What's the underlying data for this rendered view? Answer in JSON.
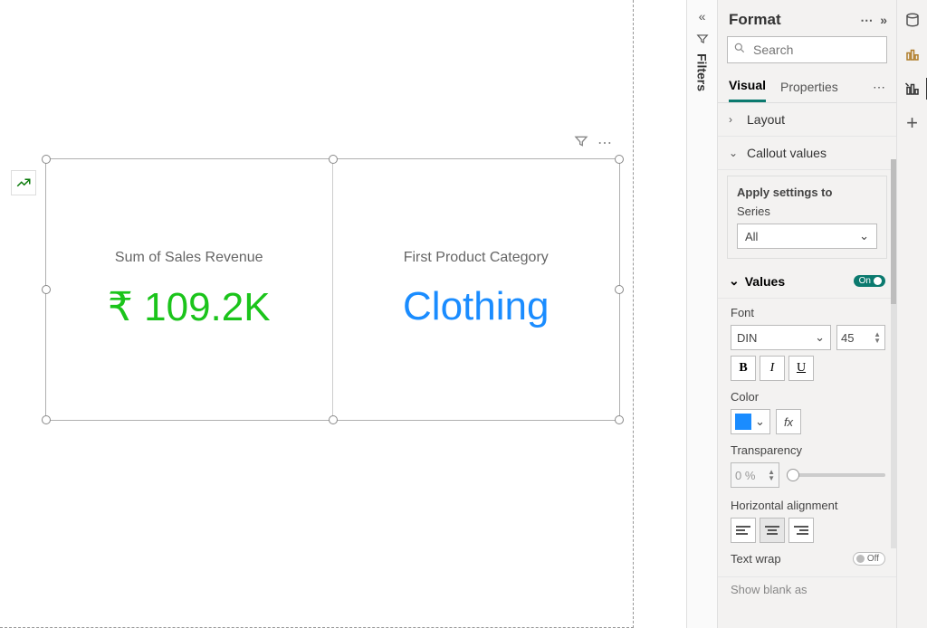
{
  "canvas": {
    "card1_title": "Sum of Sales Revenue",
    "card1_value": "₹ 109.2K",
    "card2_title": "First Product Category",
    "card2_value": "Clothing"
  },
  "filters": {
    "label": "Filters"
  },
  "format": {
    "title": "Format",
    "search_placeholder": "Search",
    "tabs": {
      "visual": "Visual",
      "properties": "Properties"
    },
    "layout": {
      "label": "Layout"
    },
    "callout": {
      "label": "Callout values",
      "apply_label": "Apply settings to",
      "series_label": "Series",
      "series_value": "All"
    },
    "values": {
      "label": "Values",
      "toggle": "On",
      "font_label": "Font",
      "font_family": "DIN",
      "font_size": "45",
      "bold": "B",
      "italic": "I",
      "underline": "U",
      "color_label": "Color",
      "color_hex": "#1a8cff",
      "fx": "fx",
      "transparency_label": "Transparency",
      "transparency_value": "0 %",
      "halign_label": "Horizontal alignment",
      "textwrap_label": "Text wrap",
      "textwrap_toggle": "Off",
      "show_blank": "Show blank as"
    }
  }
}
